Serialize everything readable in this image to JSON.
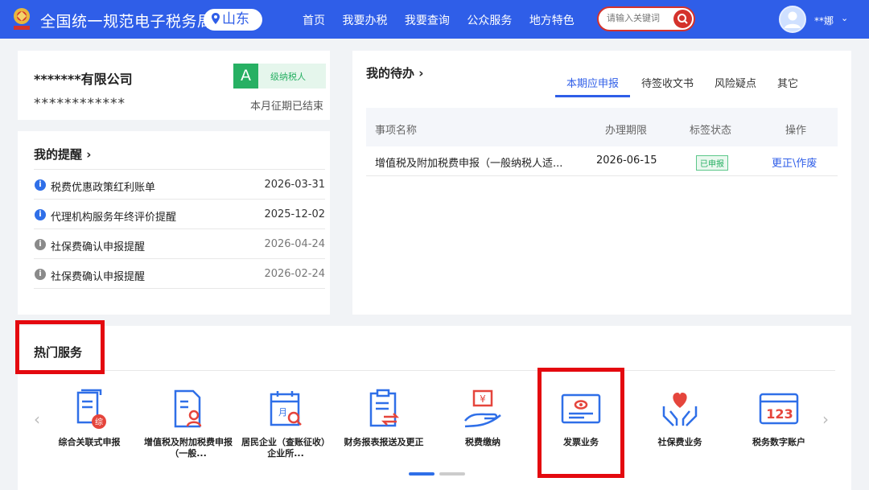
{
  "header": {
    "title": "全国统一规范电子税务局",
    "region": "山东",
    "nav": [
      "首页",
      "我要办税",
      "我要查询",
      "公众服务",
      "地方特色"
    ],
    "search_placeholder": "请输入关键词",
    "user": "**娜",
    "colors": {
      "bar": "#2f5ee8",
      "search_border": "#d4322c"
    }
  },
  "company": {
    "name": "*******有限公司",
    "tax_id": "************",
    "grade_letter": "A",
    "grade_label": "级纳税人",
    "period_status": "本月征期已结束"
  },
  "reminders": {
    "title": "我的提醒",
    "items": [
      {
        "text": "税费优惠政策红利账单",
        "date": "2026-03-31",
        "icon": "info-blue"
      },
      {
        "text": "代理机构服务年终评价提醒",
        "date": "2025-12-02",
        "icon": "info-blue"
      },
      {
        "text": "社保费确认申报提醒",
        "date": "2026-04-24",
        "icon": "info-gray"
      },
      {
        "text": "社保费确认申报提醒",
        "date": "2026-02-24",
        "icon": "info-gray"
      }
    ]
  },
  "todo": {
    "title": "我的待办",
    "tabs": [
      "本期应申报",
      "待签收文书",
      "风险疑点",
      "其它"
    ],
    "columns": [
      "事项名称",
      "办理期限",
      "标签状态",
      "操作"
    ],
    "rows": [
      {
        "name": "增值税及附加税费申报（一般纳税人适...",
        "deadline": "2026-06-15",
        "status": "已申报",
        "action": "更正\\作废"
      }
    ]
  },
  "hot_services": {
    "title": "热门服务",
    "items": [
      {
        "label": "综合关联式申报",
        "icon": "document-zong-icon"
      },
      {
        "label": "增值税及附加税费申报（一般...",
        "icon": "document-person-icon"
      },
      {
        "label": "居民企业（查账征收）企业所...",
        "icon": "calendar-search-icon"
      },
      {
        "label": "财务报表报送及更正",
        "icon": "clipboard-exchange-icon"
      },
      {
        "label": "税费缴纳",
        "icon": "yuan-hand-icon"
      },
      {
        "label": "发票业务",
        "icon": "invoice-icon"
      },
      {
        "label": "社保费业务",
        "icon": "heart-hands-icon"
      },
      {
        "label": "税务数字账户",
        "icon": "card-123-icon"
      }
    ]
  }
}
